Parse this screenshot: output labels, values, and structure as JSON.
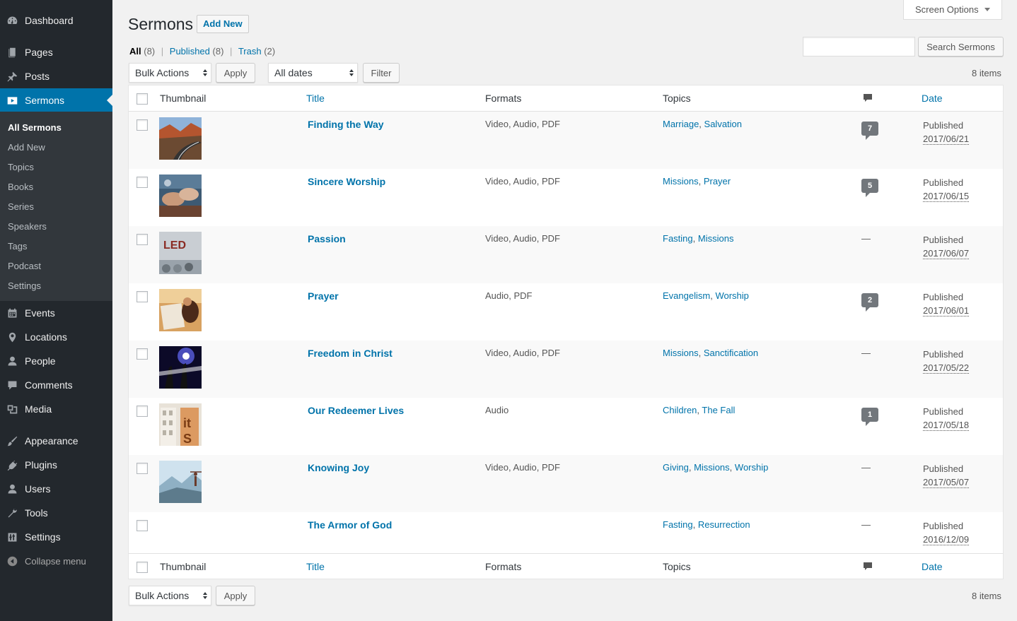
{
  "sidebar": {
    "dashboard": "Dashboard",
    "pages": "Pages",
    "posts": "Posts",
    "sermons": "Sermons",
    "submenu": [
      "All Sermons",
      "Add New",
      "Topics",
      "Books",
      "Series",
      "Speakers",
      "Tags",
      "Podcast",
      "Settings"
    ],
    "events": "Events",
    "locations": "Locations",
    "people": "People",
    "comments": "Comments",
    "media": "Media",
    "appearance": "Appearance",
    "plugins": "Plugins",
    "users": "Users",
    "tools": "Tools",
    "settings": "Settings",
    "collapse": "Collapse menu"
  },
  "header": {
    "title": "Sermons",
    "add_new": "Add New",
    "screen_options": "Screen Options"
  },
  "views": {
    "all_label": "All",
    "all_count": "(8)",
    "published_label": "Published",
    "published_count": "(8)",
    "trash_label": "Trash",
    "trash_count": "(2)",
    "sep": "|"
  },
  "search": {
    "value": "",
    "button": "Search Sermons"
  },
  "toolbar": {
    "bulk_actions": "Bulk Actions",
    "apply": "Apply",
    "all_dates": "All dates",
    "filter": "Filter",
    "items": "8 items"
  },
  "columns": {
    "thumbnail": "Thumbnail",
    "title": "Title",
    "formats": "Formats",
    "topics": "Topics",
    "date": "Date"
  },
  "rows": [
    {
      "title": "Finding the Way",
      "formats": "Video, Audio, PDF",
      "topics": [
        "Marriage",
        "Salvation"
      ],
      "comments": "7",
      "status": "Published",
      "date": "2017/06/21",
      "thumb": "road"
    },
    {
      "title": "Sincere Worship",
      "formats": "Video, Audio, PDF",
      "topics": [
        "Missions",
        "Prayer"
      ],
      "comments": "5",
      "status": "Published",
      "date": "2017/06/15",
      "thumb": "hands"
    },
    {
      "title": "Passion",
      "formats": "Video, Audio, PDF",
      "topics": [
        "Fasting",
        "Missions"
      ],
      "comments": "—",
      "status": "Published",
      "date": "2017/06/07",
      "thumb": "led"
    },
    {
      "title": "Prayer",
      "formats": "Audio, PDF",
      "topics": [
        "Evangelism",
        "Worship"
      ],
      "comments": "2",
      "status": "Published",
      "date": "2017/06/01",
      "thumb": "bible"
    },
    {
      "title": "Freedom in Christ",
      "formats": "Video, Audio, PDF",
      "topics": [
        "Missions",
        "Sanctification"
      ],
      "comments": "—",
      "status": "Published",
      "date": "2017/05/22",
      "thumb": "concert"
    },
    {
      "title": "Our Redeemer Lives",
      "formats": "Audio",
      "topics": [
        "Children",
        "The Fall"
      ],
      "comments": "1",
      "status": "Published",
      "date": "2017/05/18",
      "thumb": "building"
    },
    {
      "title": "Knowing Joy",
      "formats": "Video, Audio, PDF",
      "topics": [
        "Giving",
        "Missions",
        "Worship"
      ],
      "comments": "—",
      "status": "Published",
      "date": "2017/05/07",
      "thumb": "mountain"
    },
    {
      "title": "The Armor of God",
      "formats": "",
      "topics": [
        "Fasting",
        "Resurrection"
      ],
      "comments": "—",
      "status": "Published",
      "date": "2016/12/09",
      "thumb": "none"
    }
  ]
}
